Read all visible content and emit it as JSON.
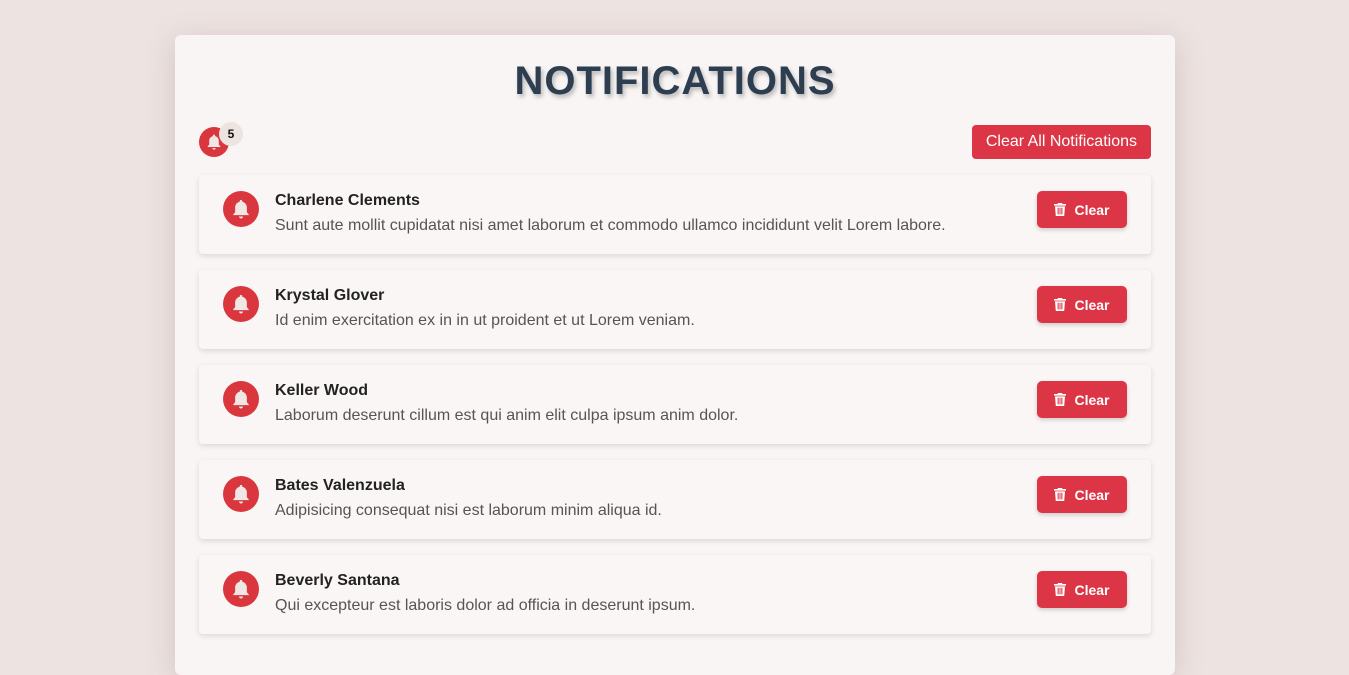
{
  "header": {
    "title": "NOTIFICATIONS",
    "badge_count": "5",
    "clear_all_label": "Clear All Notifications"
  },
  "colors": {
    "accent": "#dc3545",
    "icon_bg": "#d9363e",
    "title": "#2c3e50",
    "page_bg": "#ede3e1"
  },
  "icons": {
    "notification": "bell-icon",
    "clear": "trash-icon"
  },
  "notifications": [
    {
      "name": "Charlene Clements",
      "message": "Sunt aute mollit cupidatat nisi amet laborum et commodo ullamco incididunt velit Lorem labore.",
      "clear_label": "Clear"
    },
    {
      "name": "Krystal Glover",
      "message": "Id enim exercitation ex in in ut proident et ut Lorem veniam.",
      "clear_label": "Clear"
    },
    {
      "name": "Keller Wood",
      "message": "Laborum deserunt cillum est qui anim elit culpa ipsum anim dolor.",
      "clear_label": "Clear"
    },
    {
      "name": "Bates Valenzuela",
      "message": "Adipisicing consequat nisi est laborum minim aliqua id.",
      "clear_label": "Clear"
    },
    {
      "name": "Beverly Santana",
      "message": "Qui excepteur est laboris dolor ad officia in deserunt ipsum.",
      "clear_label": "Clear"
    }
  ]
}
